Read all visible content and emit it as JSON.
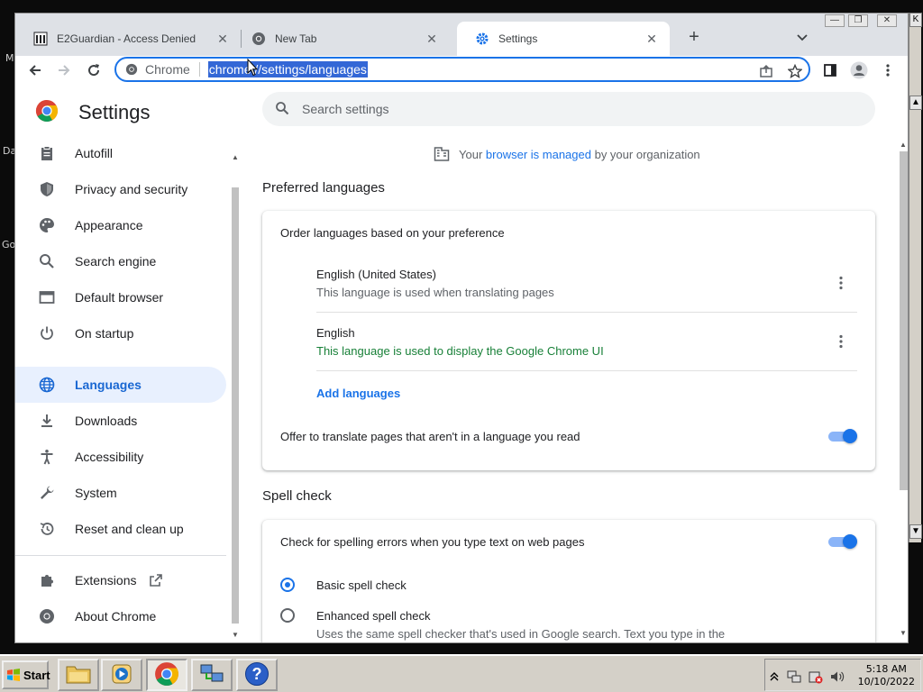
{
  "desktop": {
    "frag_m": "M",
    "frag_da": "Da",
    "frag_go": "Go",
    "frag_k": "K"
  },
  "browser": {
    "tabs": [
      {
        "title": "E2Guardian - Access Denied",
        "icon": "bank-icon"
      },
      {
        "title": "New Tab",
        "icon": "chrome-icon"
      },
      {
        "title": "Settings",
        "icon": "gear-icon",
        "active": true
      }
    ],
    "omnibox": {
      "chip_label": "Chrome",
      "url": "chrome://settings/languages"
    }
  },
  "settings": {
    "title": "Settings",
    "search_placeholder": "Search settings",
    "nav": [
      {
        "label": "Autofill",
        "icon": "clipboard-icon"
      },
      {
        "label": "Privacy and security",
        "icon": "shield-icon"
      },
      {
        "label": "Appearance",
        "icon": "palette-icon"
      },
      {
        "label": "Search engine",
        "icon": "search-icon"
      },
      {
        "label": "Default browser",
        "icon": "browser-icon"
      },
      {
        "label": "On startup",
        "icon": "power-icon"
      },
      {
        "label": "Languages",
        "icon": "globe-icon",
        "active": true
      },
      {
        "label": "Downloads",
        "icon": "download-icon"
      },
      {
        "label": "Accessibility",
        "icon": "accessibility-icon"
      },
      {
        "label": "System",
        "icon": "wrench-icon"
      },
      {
        "label": "Reset and clean up",
        "icon": "history-icon"
      },
      {
        "label": "Extensions",
        "icon": "puzzle-icon"
      },
      {
        "label": "About Chrome",
        "icon": "chrome-icon"
      }
    ],
    "managed": {
      "prefix": "Your",
      "link": "browser is managed",
      "suffix": "by your organization"
    },
    "preferred": {
      "heading": "Preferred languages",
      "order_label": "Order languages based on your preference",
      "languages": [
        {
          "name": "English (United States)",
          "desc": "This language is used when translating pages"
        },
        {
          "name": "English",
          "desc": "This language is used to display the Google Chrome UI"
        }
      ],
      "add_label": "Add languages",
      "offer_translate": "Offer to translate pages that aren't in a language you read"
    },
    "spell": {
      "heading": "Spell check",
      "check_label": "Check for spelling errors when you type text on web pages",
      "basic": "Basic spell check",
      "enhanced": "Enhanced spell check",
      "enhanced_desc": "Uses the same spell checker that's used in Google search. Text you type in the"
    }
  },
  "taskbar": {
    "start_label": "Start",
    "time": "5:18 AM",
    "date": "10/10/2022"
  },
  "colors": {
    "accent": "#1a73e8",
    "active_nav_bg": "#e8f0fe",
    "green_desc": "#188038"
  }
}
